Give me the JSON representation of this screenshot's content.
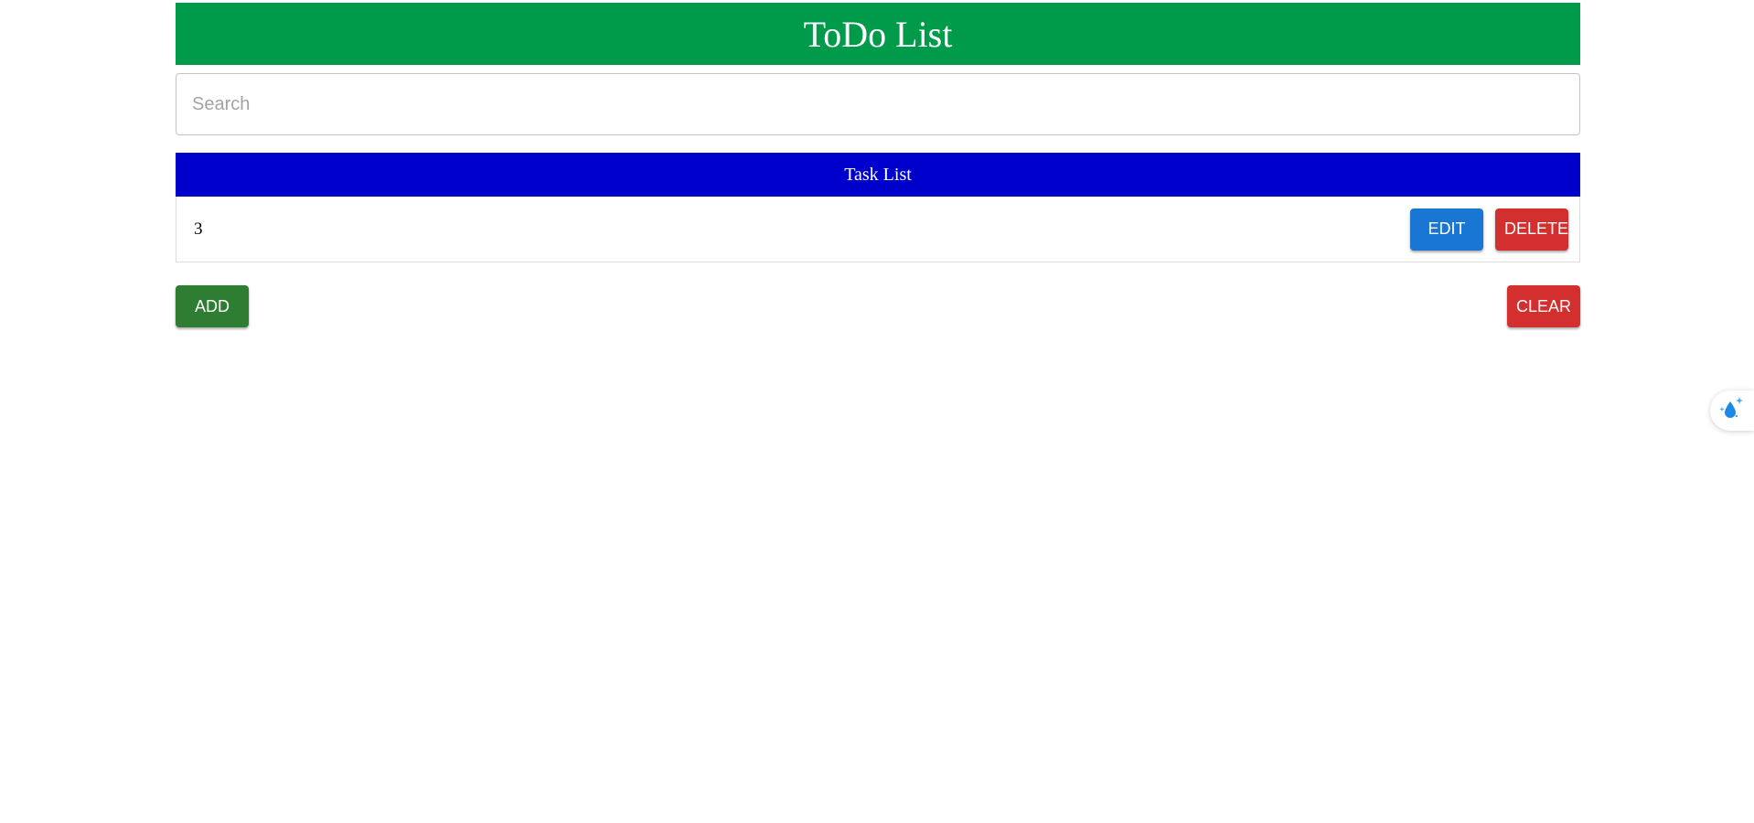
{
  "header": {
    "title": "ToDo List"
  },
  "search": {
    "placeholder": "Search",
    "value": ""
  },
  "task_list": {
    "heading": "Task List",
    "items": [
      {
        "text": "3",
        "edit_label": "EDIT",
        "delete_label": "DELETE"
      }
    ]
  },
  "actions": {
    "add_label": "ADD",
    "clear_label": "CLEAR"
  },
  "colors": {
    "header_bg": "#009a4b",
    "task_header_bg": "#0000cc",
    "edit": "#1976d2",
    "delete": "#d32f2f",
    "add": "#2e7d32",
    "clear": "#d32f2f"
  },
  "floating_widget": {
    "icon": "sparkle-droplet-icon"
  }
}
